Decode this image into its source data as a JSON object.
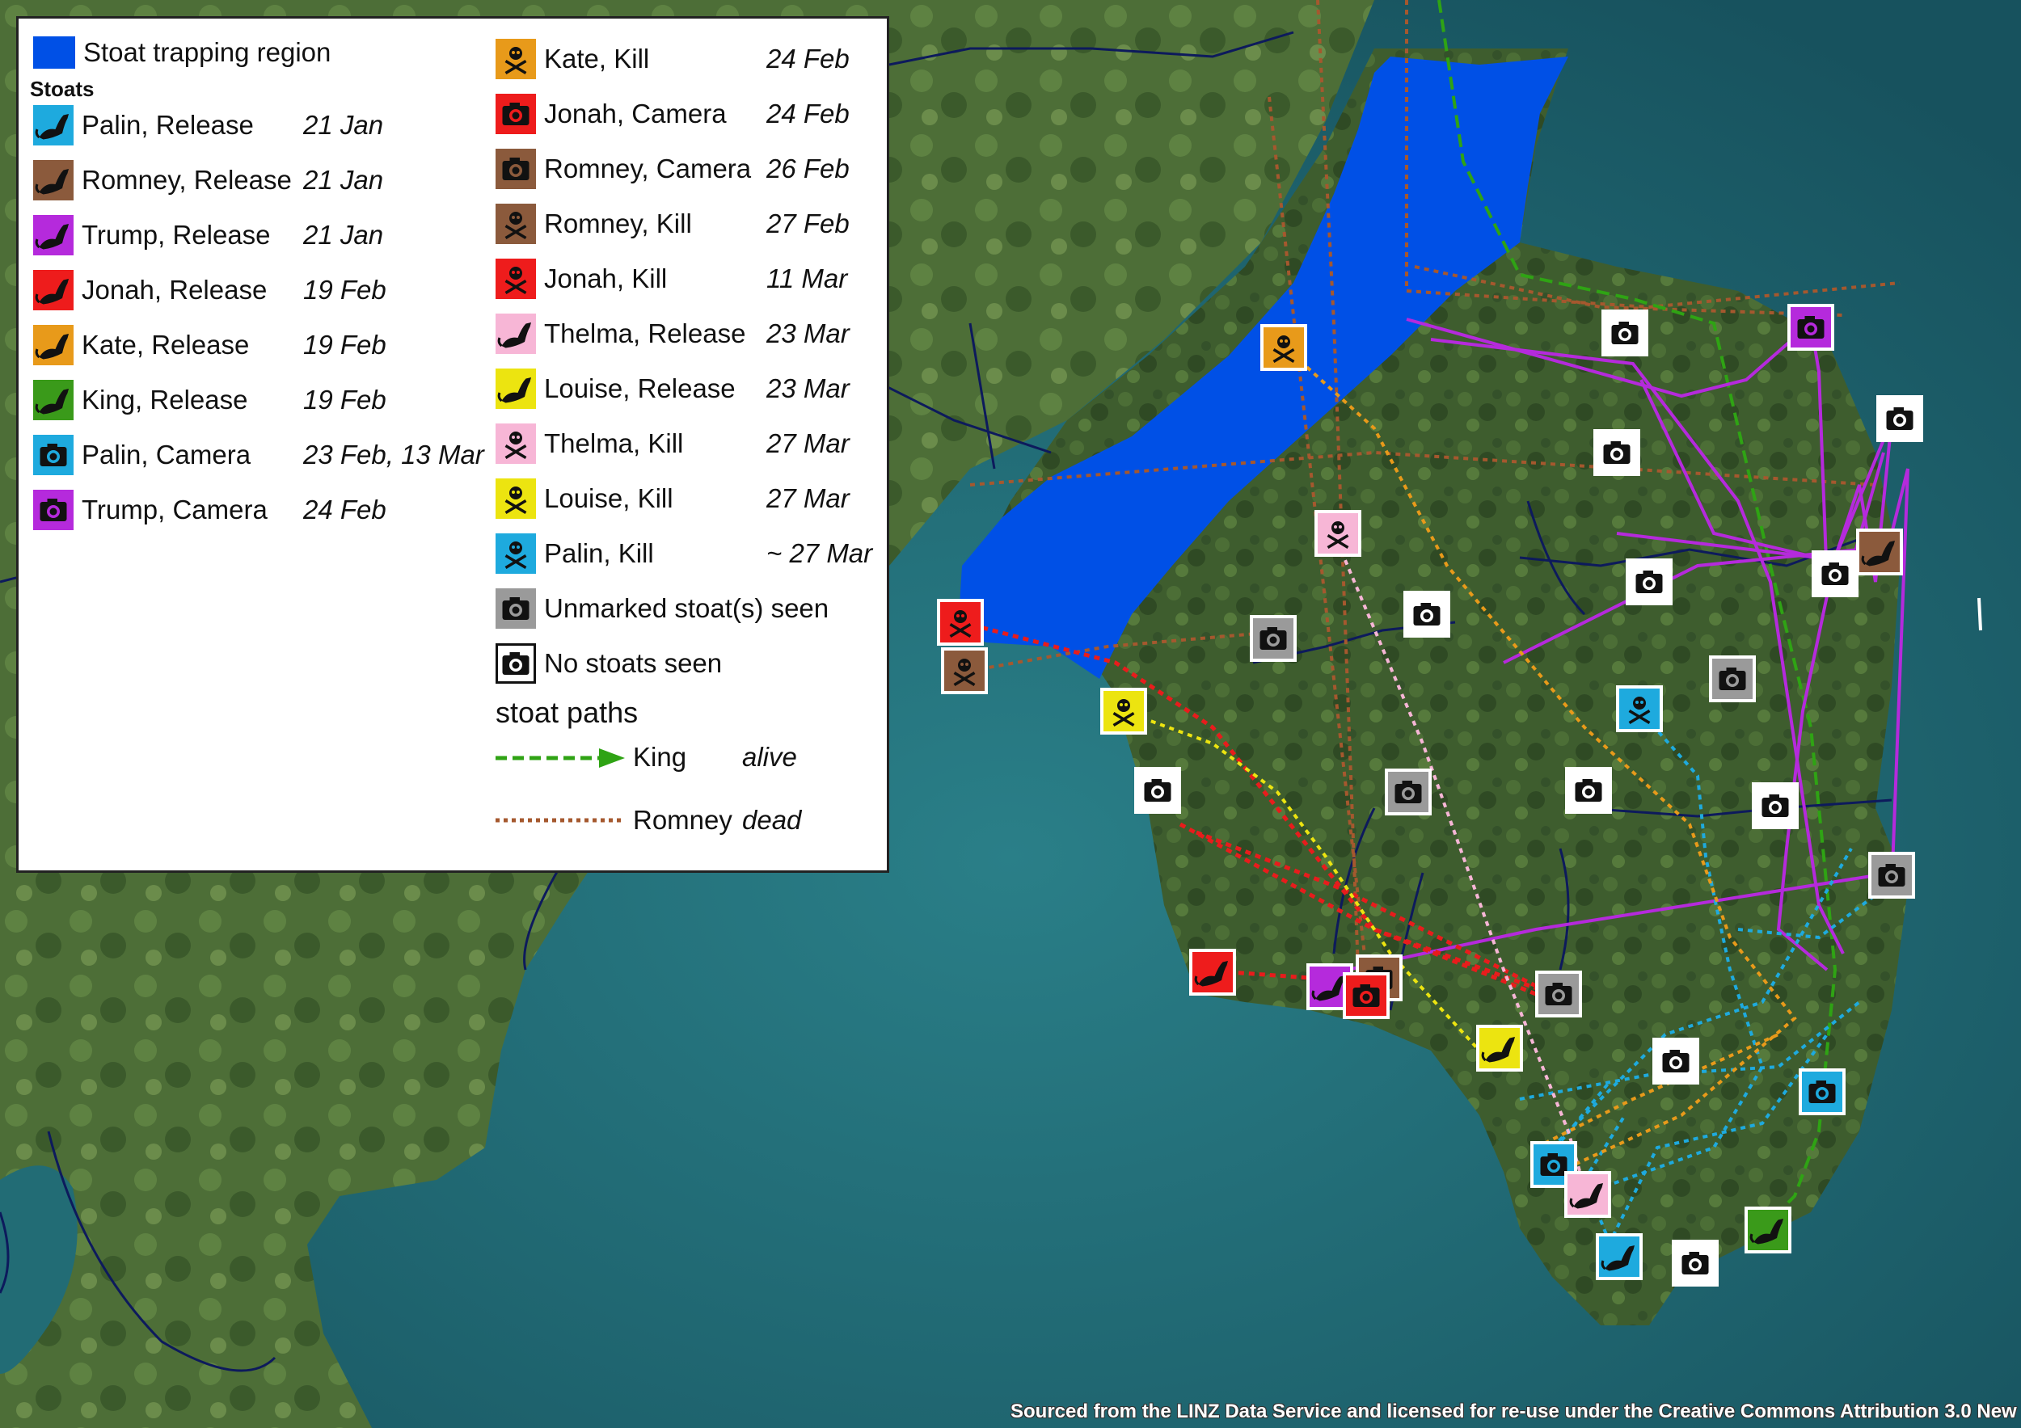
{
  "colors": {
    "trapping_region": "#0050e6",
    "palin": "#1eaade",
    "romney": "#8b5a3c",
    "trump": "#b52adc",
    "jonah": "#ee1c1c",
    "kate": "#e89a1a",
    "king": "#3a9a1a",
    "thelma": "#f7b6d6",
    "louise": "#ece410",
    "unmarked": "#9a9a9a",
    "none": "#ffffff"
  },
  "legend": {
    "region_label": "Stoat trapping region",
    "stoats_heading": "Stoats",
    "left_items": [
      {
        "label": "Palin, Release",
        "date": "21 Jan",
        "icon": "stoat-icon",
        "color": "palin"
      },
      {
        "label": "Romney, Release",
        "date": "21 Jan",
        "icon": "stoat-icon",
        "color": "romney"
      },
      {
        "label": "Trump, Release",
        "date": "21 Jan",
        "icon": "stoat-icon",
        "color": "trump"
      },
      {
        "label": "Jonah, Release",
        "date": "19 Feb",
        "icon": "stoat-icon",
        "color": "jonah"
      },
      {
        "label": "Kate, Release",
        "date": "19 Feb",
        "icon": "stoat-icon",
        "color": "kate"
      },
      {
        "label": "King, Release",
        "date": "19 Feb",
        "icon": "stoat-icon",
        "color": "king"
      },
      {
        "label": "Palin, Camera",
        "date": "23 Feb, 13 Mar",
        "icon": "camera-icon",
        "color": "palin"
      },
      {
        "label": "Trump, Camera",
        "date": "24 Feb",
        "icon": "camera-icon",
        "color": "trump"
      }
    ],
    "right_items": [
      {
        "label": "Kate, Kill",
        "date": "24 Feb",
        "icon": "skull-icon",
        "color": "kate"
      },
      {
        "label": "Jonah, Camera",
        "date": "24 Feb",
        "icon": "camera-icon",
        "color": "jonah"
      },
      {
        "label": "Romney, Camera",
        "date": "26 Feb",
        "icon": "camera-icon",
        "color": "romney"
      },
      {
        "label": "Romney, Kill",
        "date": "27 Feb",
        "icon": "skull-icon",
        "color": "romney"
      },
      {
        "label": "Jonah, Kill",
        "date": "11 Mar",
        "icon": "skull-icon",
        "color": "jonah"
      },
      {
        "label": "Thelma, Release",
        "date": "23 Mar",
        "icon": "stoat-icon",
        "color": "thelma"
      },
      {
        "label": "Louise, Release",
        "date": "23 Mar",
        "icon": "stoat-icon",
        "color": "louise"
      },
      {
        "label": "Thelma, Kill",
        "date": "27 Mar",
        "icon": "skull-icon",
        "color": "thelma"
      },
      {
        "label": "Louise, Kill",
        "date": "27 Mar",
        "icon": "skull-icon",
        "color": "louise"
      },
      {
        "label": "Palin, Kill",
        "date": "~ 27 Mar",
        "icon": "skull-icon",
        "color": "palin"
      },
      {
        "label": "Unmarked stoat(s) seen",
        "date": "",
        "icon": "camera-icon",
        "color": "unmarked"
      },
      {
        "label": "No stoats seen",
        "date": "",
        "icon": "camera-icon",
        "color": "none"
      }
    ],
    "paths_heading": "stoat paths",
    "paths": [
      {
        "name": "King",
        "status": "alive",
        "color": "king"
      },
      {
        "name": "Romney",
        "status": "dead",
        "color": "romney"
      }
    ]
  },
  "credit": "Sourced from the LINZ Data Service and licensed for re-use under the Creative Commons Attribution 3.0 New"
}
